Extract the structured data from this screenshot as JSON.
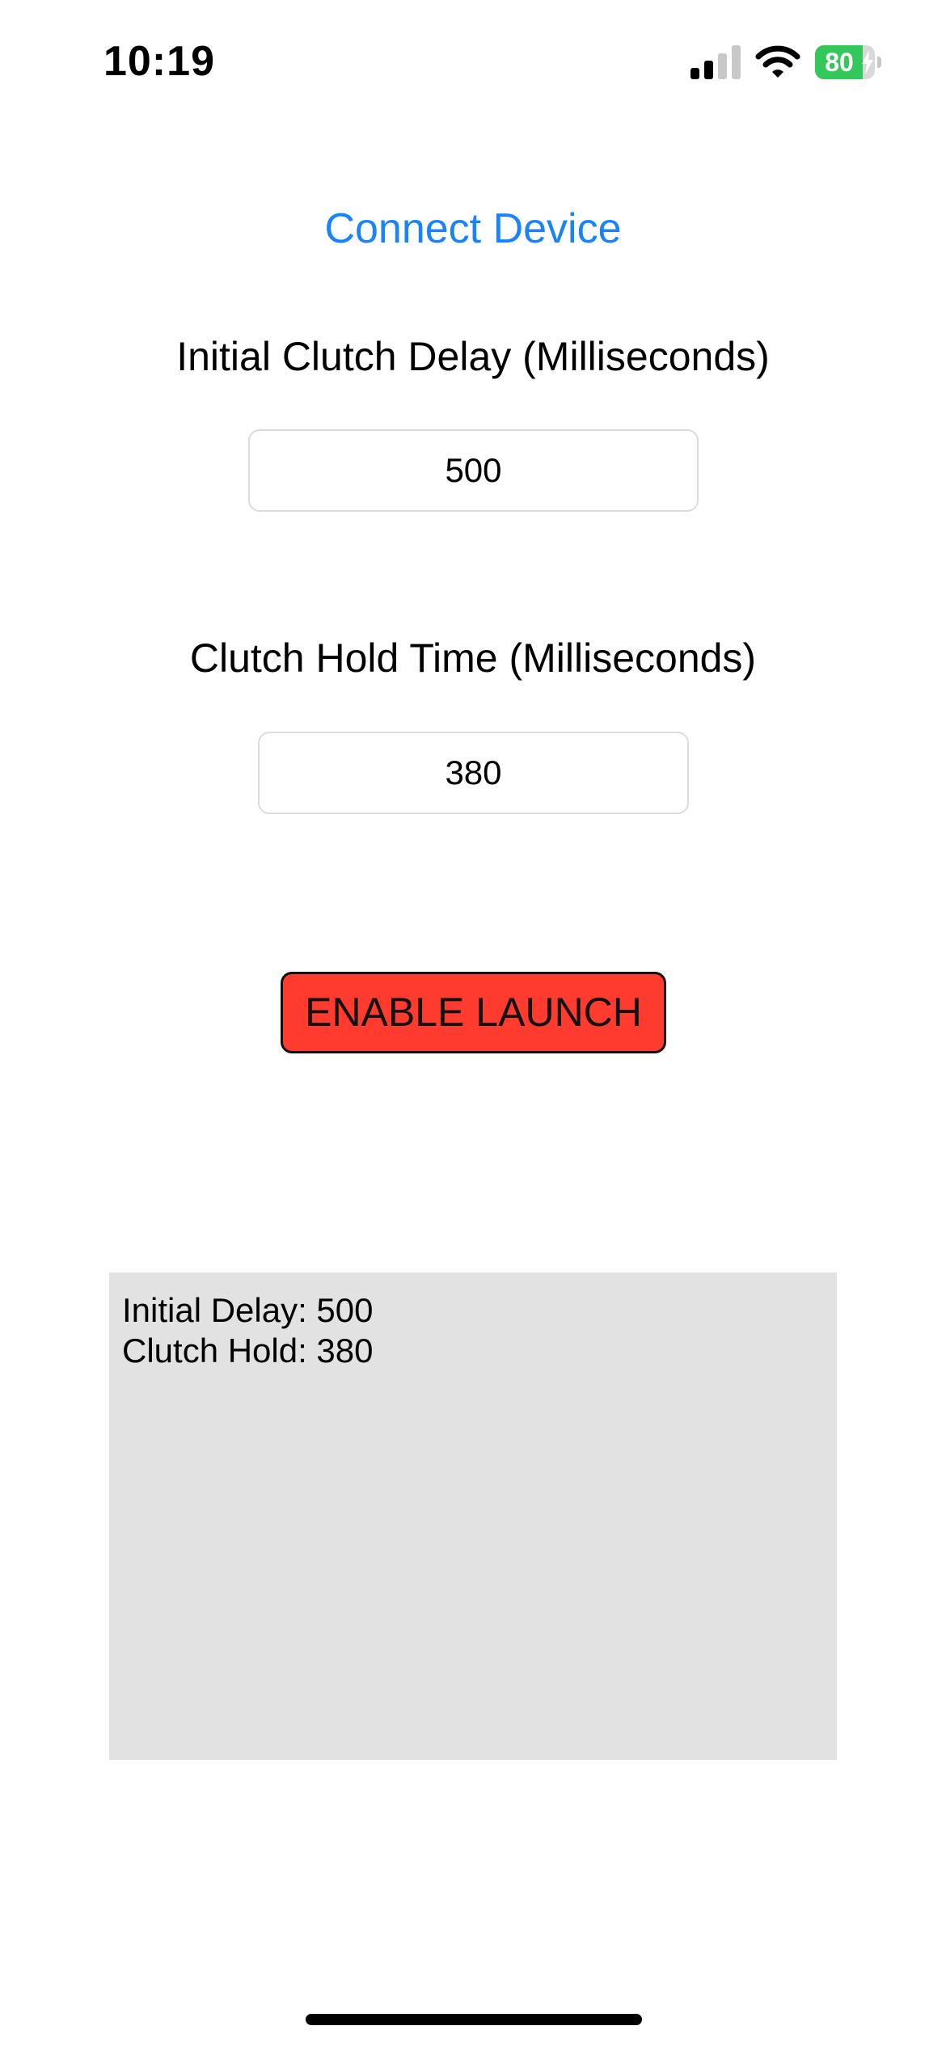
{
  "status_bar": {
    "time": "10:19",
    "battery_percent": 80,
    "battery_label": "80",
    "charging": true,
    "signal_bars_active": 2,
    "signal_bars_total": 4,
    "icons": [
      "signal-icon",
      "wifi-icon",
      "battery-icon",
      "bolt-icon"
    ],
    "colors": {
      "battery": "#34c759"
    }
  },
  "main": {
    "connect_label": "Connect Device",
    "initial_delay_label": "Initial Clutch Delay (Milliseconds)",
    "initial_delay_value": "500",
    "hold_time_label": "Clutch Hold Time (Milliseconds)",
    "hold_time_value": "380",
    "launch_label": "ENABLE LAUNCH"
  },
  "log": {
    "lines": [
      "Initial Delay: 500",
      "Clutch Hold: 380"
    ]
  },
  "colors": {
    "link": "#1a82fb",
    "launch_button": "#ff3b30",
    "log_background": "#e2e2e2"
  }
}
